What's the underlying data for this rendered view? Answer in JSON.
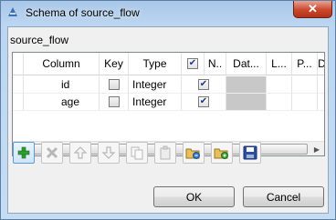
{
  "window": {
    "title": "Schema of source_flow",
    "close_glyph": "✕"
  },
  "schema_name": "source_flow",
  "table": {
    "headers": {
      "column": "Column",
      "key": "Key",
      "type": "Type",
      "nullable": "N..",
      "date_pattern": "Dat...",
      "length": "L...",
      "precision": "P...",
      "default": "D..."
    },
    "header_checkbox_checked": true,
    "rows": [
      {
        "name": "id",
        "key": false,
        "type": "Integer",
        "nullable": true
      },
      {
        "name": "age",
        "key": false,
        "type": "Integer",
        "nullable": true
      }
    ],
    "scrollbar_grip": "III"
  },
  "toolbar": {
    "icons": [
      "add-icon",
      "remove-icon",
      "move-up-icon",
      "move-down-icon",
      "copy-icon",
      "paste-icon",
      "import-icon",
      "export-icon",
      "save-icon"
    ]
  },
  "buttons": {
    "ok": "OK",
    "cancel": "Cancel"
  },
  "colors": {
    "add": "#2e9d2e",
    "save": "#2c4fa3",
    "accent_border": "#5d9ad6"
  }
}
